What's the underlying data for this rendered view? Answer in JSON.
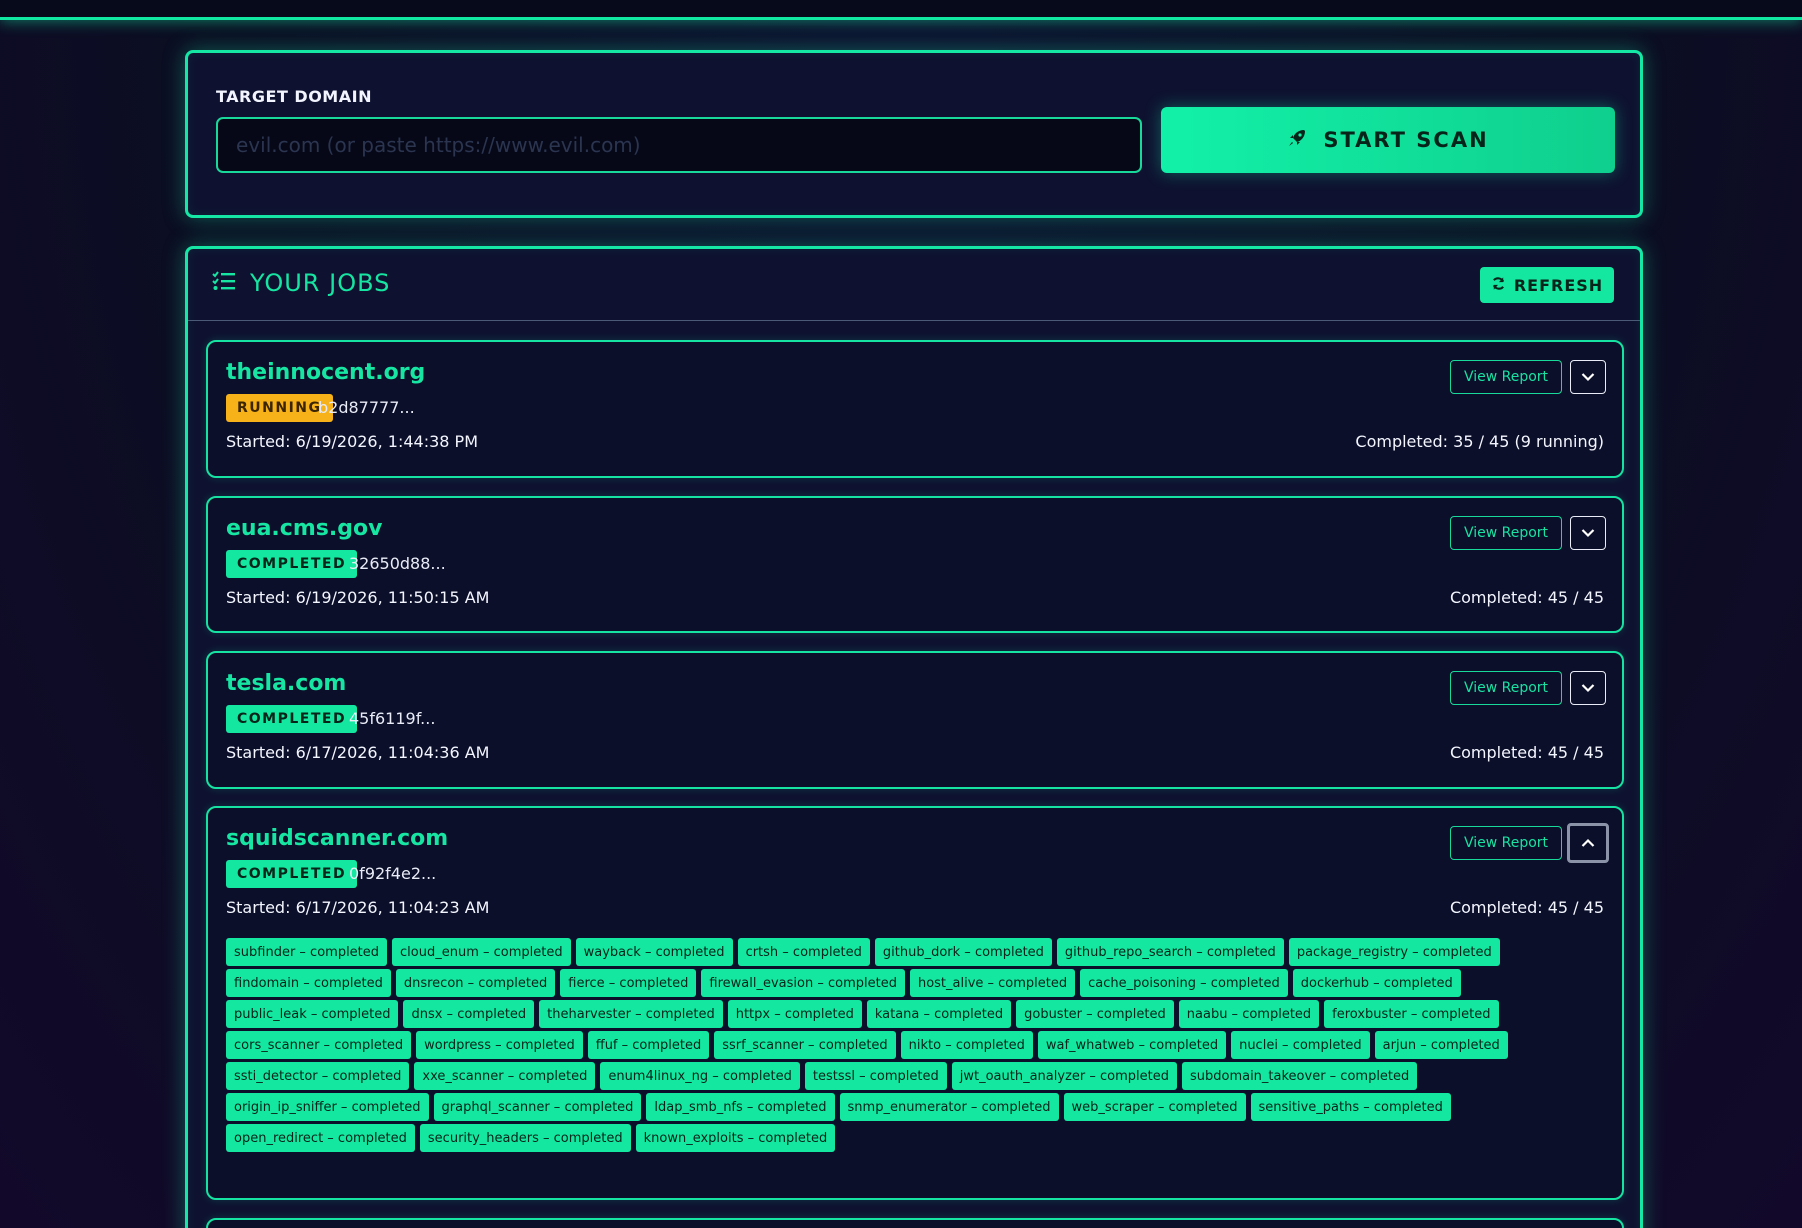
{
  "scan": {
    "label": "TARGET DOMAIN",
    "placeholder": "evil.com (or paste https://www.evil.com)",
    "start_label": "START SCAN"
  },
  "jobs_header": {
    "title": "YOUR JOBS",
    "refresh_label": "REFRESH"
  },
  "jobs": [
    {
      "domain": "theinnocent.org",
      "status": "RUNNING",
      "id": "b2d87777...",
      "started": "Started: 6/19/2026, 1:44:38 PM",
      "completed": "Completed: 35 / 45 (9 running)",
      "view_report": "View Report"
    },
    {
      "domain": "eua.cms.gov",
      "status": "COMPLETED",
      "id": "32650d88...",
      "started": "Started: 6/19/2026, 11:50:15 AM",
      "completed": "Completed: 45 / 45",
      "view_report": "View Report"
    },
    {
      "domain": "tesla.com",
      "status": "COMPLETED",
      "id": "45f6119f...",
      "started": "Started: 6/17/2026, 11:04:36 AM",
      "completed": "Completed: 45 / 45",
      "view_report": "View Report"
    },
    {
      "domain": "squidscanner.com",
      "status": "COMPLETED",
      "id": "0f92f4e2...",
      "started": "Started: 6/17/2026, 11:04:23 AM",
      "completed": "Completed: 45 / 45",
      "view_report": "View Report",
      "tools": [
        "subfinder – completed",
        "cloud_enum – completed",
        "wayback – completed",
        "crtsh – completed",
        "github_dork – completed",
        "github_repo_search – completed",
        "package_registry – completed",
        "findomain – completed",
        "dnsrecon – completed",
        "fierce – completed",
        "firewall_evasion – completed",
        "host_alive – completed",
        "cache_poisoning – completed",
        "dockerhub – completed",
        "public_leak – completed",
        "dnsx – completed",
        "theharvester – completed",
        "httpx – completed",
        "katana – completed",
        "gobuster – completed",
        "naabu – completed",
        "feroxbuster – completed",
        "cors_scanner – completed",
        "wordpress – completed",
        "ffuf – completed",
        "ssrf_scanner – completed",
        "nikto – completed",
        "waf_whatweb – completed",
        "nuclei – completed",
        "arjun – completed",
        "ssti_detector – completed",
        "xxe_scanner – completed",
        "enum4linux_ng – completed",
        "testssl – completed",
        "jwt_oauth_analyzer – completed",
        "subdomain_takeover – completed",
        "origin_ip_sniffer – completed",
        "graphql_scanner – completed",
        "ldap_smb_nfs – completed",
        "snmp_enumerator – completed",
        "web_scraper – completed",
        "sensitive_paths – completed",
        "open_redirect – completed",
        "security_headers – completed",
        "known_exploits – completed"
      ]
    }
  ],
  "colors": {
    "accent": "#14e8a0",
    "running": "#f7b21a",
    "background": "#0c0f24"
  }
}
